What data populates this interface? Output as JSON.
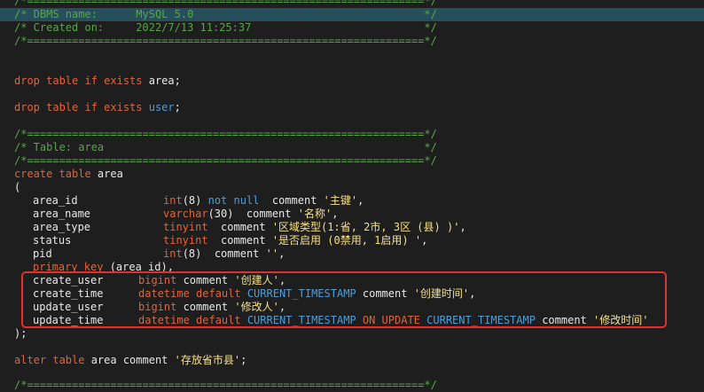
{
  "lines": {
    "l0": "/*==============================================================*/",
    "l1": "/* DBMS name:      MySQL 5.0                                    */",
    "l2": "/* Created on:     2022/7/13 11:25:37                           */",
    "l3": "/*==============================================================*/",
    "drop1_kw": "drop table if exists ",
    "drop1_name": "area",
    "drop1_end": ";",
    "drop2_kw": "drop table if exists ",
    "drop2_name": "user",
    "drop2_end": ";",
    "t0": "/*==============================================================*/",
    "t1": "/* Table: area                                                  */",
    "t2": "/*==============================================================*/",
    "create_kw": "create table ",
    "create_name": "area",
    "open_paren": "(",
    "close_paren": ");",
    "alter_kw": "alter table ",
    "alter_rest": "area comment ",
    "alter_str": "'存放省市县'",
    "alter_end": ";",
    "last": "/*==============================================================*/",
    "pk_kw": "primary key",
    "pk_rest": " (area_id),"
  },
  "columns": [
    {
      "name": "area_id",
      "type": "int",
      "len": "(8)",
      "extra": " not null",
      "comment_kw": "  comment ",
      "comment": "'主键'",
      "end": ","
    },
    {
      "name": "area_name",
      "type": "varchar",
      "len": "(30)",
      "extra": "",
      "comment_kw": "  comment ",
      "comment": "'名称'",
      "end": ","
    },
    {
      "name": "area_type",
      "type": "tinyint",
      "len": "",
      "extra": "",
      "comment_kw": "  comment ",
      "comment": "'区域类型(1:省, 2市, 3区 (县) )'",
      "end": ","
    },
    {
      "name": "status",
      "type": "tinyint",
      "len": "",
      "extra": "",
      "comment_kw": "  comment ",
      "comment": "'是否启用 (0禁用, 1启用) '",
      "end": ","
    },
    {
      "name": "pid",
      "type": "int",
      "len": "(8)",
      "extra": "",
      "comment_kw": "  comment ",
      "comment": "''",
      "end": ","
    }
  ],
  "audit_columns": [
    {
      "name": "create_user",
      "type": "bigint",
      "default": "",
      "on_update": "",
      "comment_kw": " comment ",
      "comment": "'创建人'",
      "end": ","
    },
    {
      "name": "create_time",
      "type": "datetime",
      "default": " default ",
      "default_val": "CURRENT_TIMESTAMP",
      "on_update": "",
      "comment_kw": " comment ",
      "comment": "'创建时间'",
      "end": ","
    },
    {
      "name": "update_user",
      "type": "bigint",
      "default": "",
      "on_update": "",
      "comment_kw": " comment ",
      "comment": "'修改人'",
      "end": ","
    },
    {
      "name": "update_time",
      "type": "datetime",
      "default": " default ",
      "default_val": "CURRENT_TIMESTAMP",
      "on_update": " ON UPDATE ",
      "on_update_val": "CURRENT_TIMESTAMP",
      "comment_kw": " comment ",
      "comment": "'修改时间'",
      "end": ""
    }
  ],
  "colors": {
    "background": "#1e1e1e",
    "comment": "#57a64a",
    "keyword": "#e0643c",
    "identifier": "#4f9dd6",
    "string": "#f5e08a",
    "highlight_box": "#e03030"
  }
}
